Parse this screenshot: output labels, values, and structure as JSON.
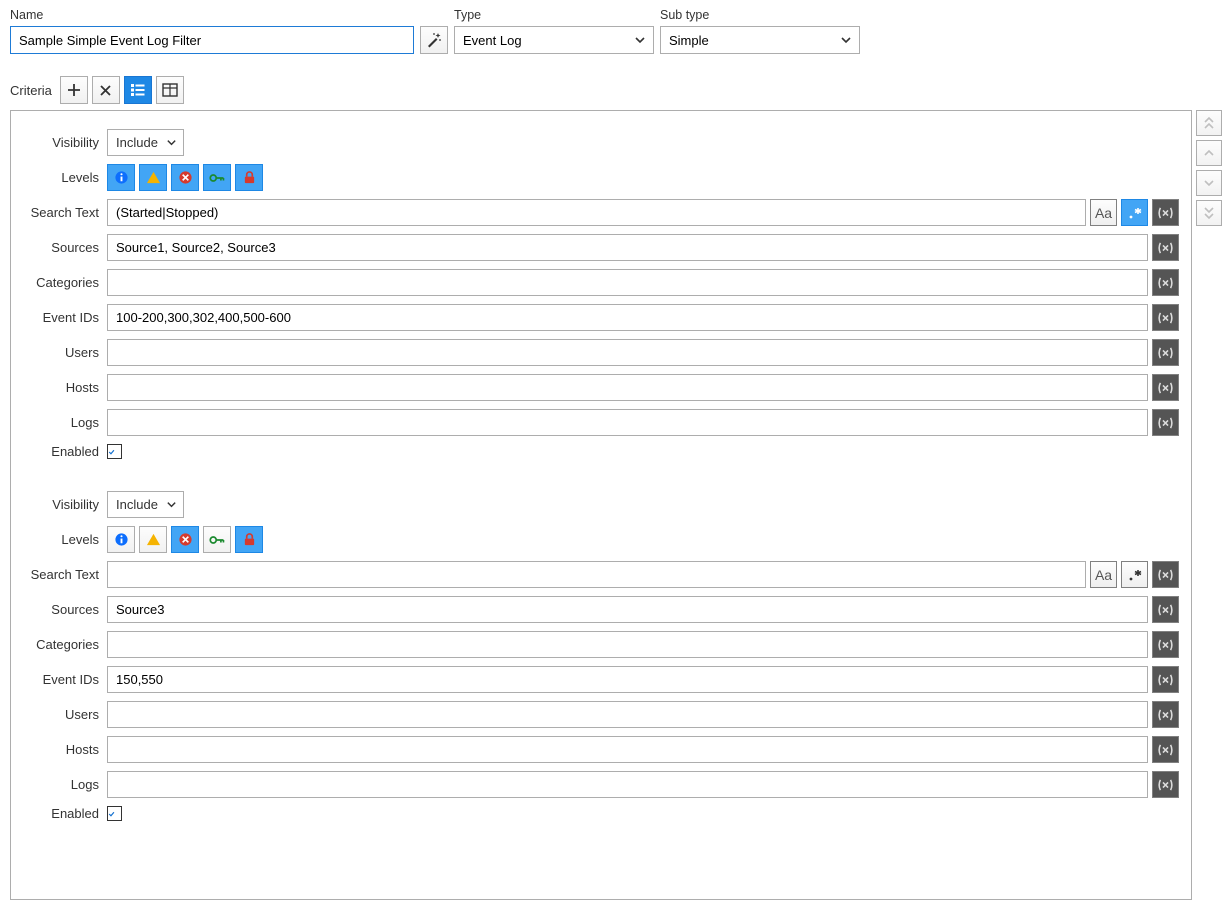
{
  "header": {
    "name_label": "Name",
    "type_label": "Type",
    "subtype_label": "Sub type",
    "name_value": "Sample Simple Event Log Filter",
    "type_value": "Event Log",
    "subtype_value": "Simple"
  },
  "criteria_label": "Criteria",
  "labels": {
    "visibility": "Visibility",
    "levels": "Levels",
    "search_text": "Search Text",
    "sources": "Sources",
    "categories": "Categories",
    "event_ids": "Event IDs",
    "users": "Users",
    "hosts": "Hosts",
    "logs": "Logs",
    "enabled": "Enabled"
  },
  "groups": [
    {
      "visibility": "Include",
      "levels": {
        "info": true,
        "warning": true,
        "error": true,
        "success": true,
        "security": true
      },
      "search_text": "(Started|Stopped)",
      "case_sensitive": false,
      "regex": true,
      "sources": "Source1, Source2, Source3",
      "categories": "",
      "event_ids": "100-200,300,302,400,500-600",
      "users": "",
      "hosts": "",
      "logs": "",
      "enabled": true
    },
    {
      "visibility": "Include",
      "levels": {
        "info": false,
        "warning": false,
        "error": true,
        "success": false,
        "security": true
      },
      "search_text": "",
      "case_sensitive": false,
      "regex": false,
      "sources": "Source3",
      "categories": "",
      "event_ids": "150,550",
      "users": "",
      "hosts": "",
      "logs": "",
      "enabled": true
    }
  ],
  "icons": {
    "wand": "magic-wand-icon",
    "plus": "plus-icon",
    "x": "close-icon",
    "list": "list-view-icon",
    "table": "table-view-icon",
    "chev_down": "chevron-down-icon",
    "dbl_up": "double-chevron-up-icon",
    "up": "chevron-up-icon",
    "down": "chevron-down-icon",
    "dbl_down": "double-chevron-down-icon",
    "info": "info-icon",
    "warning": "warning-triangle-icon",
    "error": "error-circle-icon",
    "key": "key-icon",
    "lock": "lock-icon",
    "case": "case-sensitive-icon",
    "regex": "regex-icon",
    "var": "variable-icon",
    "check": "checkmark-icon"
  },
  "aa_text": "Aa"
}
